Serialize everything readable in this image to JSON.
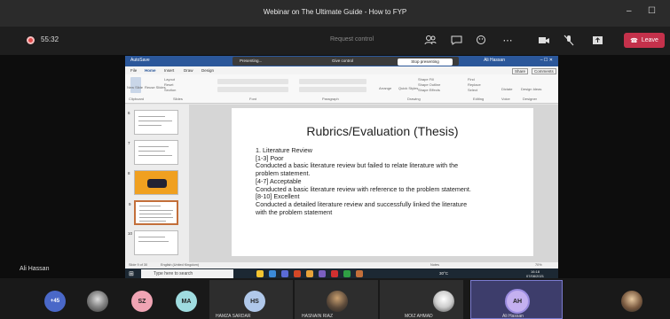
{
  "window": {
    "title": "Webinar on The Ultimate Guide - How to FYP",
    "minimize": "–",
    "maximize": "☐"
  },
  "toolbar": {
    "timer": "55:32",
    "request_control": "Request control",
    "leave_label": "Leave"
  },
  "ppt": {
    "app_title": "AutoSave",
    "account": "Ali Hassan",
    "share_presenting": "Presenting...",
    "share_give_control": "Give control",
    "stop_presenting": "Stop presenting",
    "share_btn": "Share",
    "comments_btn": "Comments",
    "tabs": [
      "File",
      "Home",
      "Insert",
      "Draw",
      "Design"
    ],
    "groups": [
      "Clipboard",
      "Slides",
      "Font",
      "Paragraph",
      "Drawing",
      "Editing",
      "Voice",
      "Designer"
    ],
    "ribbon_items": {
      "new_slide": "New Slide",
      "reuse_slides": "Reuse Slides",
      "layout": "Layout",
      "reset": "Reset",
      "section": "Section",
      "arrange": "Arrange",
      "quick_styles": "Quick Styles",
      "shape_fill": "Shape Fill",
      "shape_outline": "Shape Outline",
      "shape_effects": "Shape Effects",
      "find": "Find",
      "replace": "Replace",
      "select": "Select",
      "dictate": "Dictate",
      "design_ideas": "Design Ideas"
    },
    "thumb_numbers": [
      "6",
      "7",
      "8",
      "9",
      "10"
    ],
    "slide": {
      "title": "Rubrics/Evaluation (Thesis)",
      "lines": [
        "1. Literature Review",
        "[1-3] Poor",
        "Conducted a basic literature review but failed to relate literature with the",
        "problem statement.",
        "[4-7] Acceptable",
        "Conducted a basic literature review with reference to the problem statement.",
        "[8-10] Excellent",
        "Conducted a detailed literature review and successfully linked the literature",
        "with the problem statement"
      ]
    },
    "status": {
      "slide_info": "Slide 9 of 30",
      "language": "English (United Kingdom)",
      "notes": "Notes",
      "zoom": "70%"
    }
  },
  "taskbar": {
    "search_placeholder": "Type here to search",
    "weather": "30°C",
    "time": "16:18",
    "date": "07/08/2021"
  },
  "presenter": {
    "name": "Ali Hassan"
  },
  "participants": {
    "overflow": "+45",
    "tiles": [
      {
        "initials": "SZ"
      },
      {
        "initials": "MA"
      },
      {
        "initials": "HS",
        "name": "HAMZA SARDAR"
      },
      {
        "name": "HASNAIN RIAZ"
      },
      {
        "name": "MOIZ AHMAD"
      },
      {
        "initials": "AH",
        "name": "Ali Hassan"
      }
    ]
  },
  "colors": {
    "leave": "#c4314b",
    "ppt_brand": "#2b579a",
    "active_tile": "#7b7bd0"
  }
}
